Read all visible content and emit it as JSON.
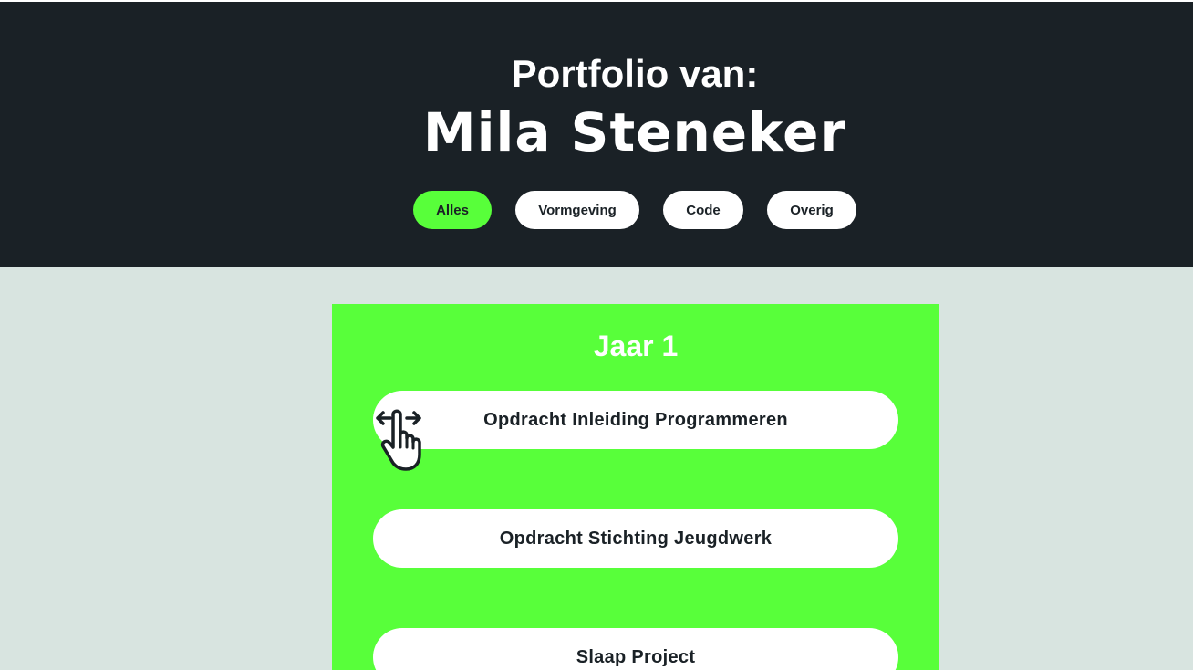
{
  "header": {
    "subtitle": "Portfolio van:",
    "name": "Mila Steneker",
    "filters": [
      {
        "label": "Alles",
        "active": true
      },
      {
        "label": "Vormgeving",
        "active": false
      },
      {
        "label": "Code",
        "active": false
      },
      {
        "label": "Overig",
        "active": false
      }
    ]
  },
  "main": {
    "section_title": "Jaar 1",
    "projects": [
      {
        "label": "Opdracht Inleiding Programmeren"
      },
      {
        "label": "Opdracht Stichting Jeugdwerk"
      },
      {
        "label": "Slaap Project"
      }
    ]
  },
  "colors": {
    "header_bg": "#1a2126",
    "page_bg": "#d8e4e0",
    "accent": "#58ff3a",
    "button_bg": "#ffffff",
    "text_dark": "#1a2126"
  },
  "icons": {
    "cursor": "hand-pointer-horizontal-resize-icon"
  }
}
